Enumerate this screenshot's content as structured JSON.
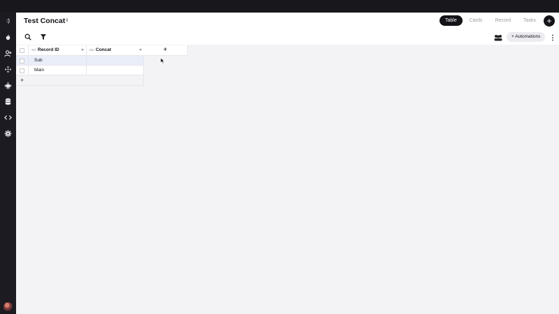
{
  "app": {
    "title": "Test Concat"
  },
  "sidebar": {
    "logo_glyph": ":)",
    "items": [
      {
        "icon": "fire-icon"
      },
      {
        "icon": "user-add-icon"
      },
      {
        "icon": "move-icon"
      },
      {
        "icon": "robot-icon"
      },
      {
        "icon": "database-icon"
      },
      {
        "icon": "code-icon"
      },
      {
        "icon": "gear-icon"
      }
    ]
  },
  "header": {
    "info_glyph": "i",
    "views": [
      "Table",
      "Cards",
      "Record",
      "Tasks"
    ],
    "active_view": "Table",
    "add_glyph": "+"
  },
  "toolbar": {
    "automations_label": "+ Automations"
  },
  "table": {
    "columns": [
      {
        "type_glyph": "#id",
        "label": "Record ID"
      },
      {
        "type_glyph": "abc",
        "label": "Concat"
      }
    ],
    "add_column_glyph": "+",
    "rows": [
      {
        "record_id": "Sub",
        "concat": ""
      },
      {
        "record_id": "Main",
        "concat": ""
      }
    ],
    "add_row_glyph": "+"
  },
  "colors": {
    "sidebar_bg": "#1c1b21",
    "accent_dark": "#141318",
    "selected_row": "#e9eef8",
    "canvas_bg": "#f3f2f5"
  }
}
